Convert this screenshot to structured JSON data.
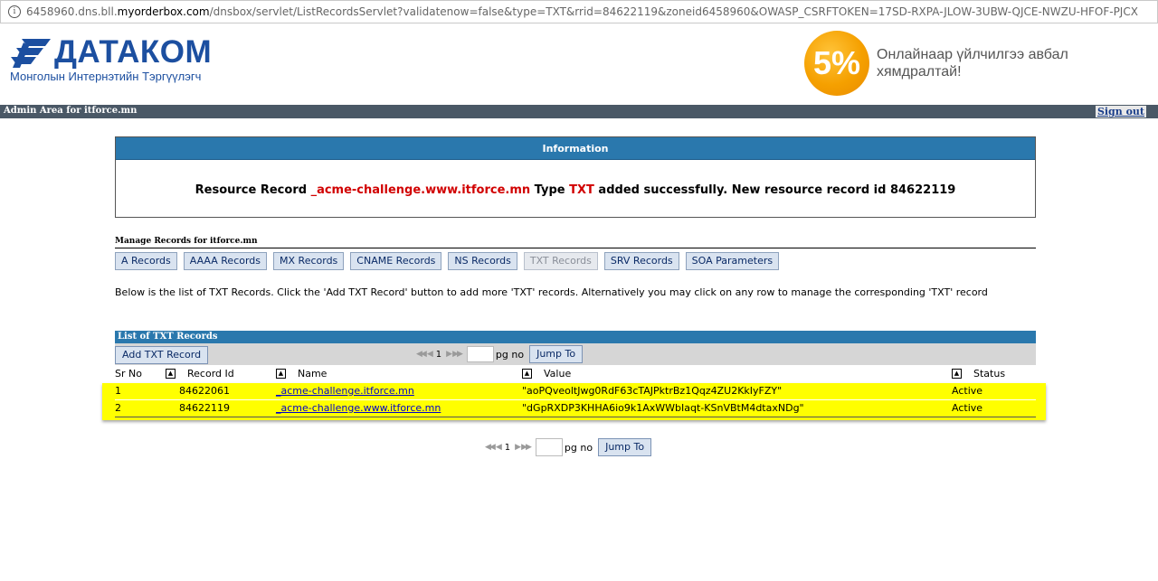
{
  "browser": {
    "url_host_prefix": "6458960.dns.bll.",
    "url_host_domain": "myorderbox.com",
    "url_rest": "/dnsbox/servlet/ListRecordsServlet?validatenow=false&type=TXT&rrid=84622119&zoneid6458960&OWASP_CSRFTOKEN=17SD-RXPA-JLOW-3UBW-QJCE-NWZU-HFOF-PJCX"
  },
  "header": {
    "logo_title": "ДАТАКОМ",
    "logo_subtitle": "Монголын Интернэтийн Тэргүүлэгч",
    "promo_badge": "5%",
    "promo_text": "Онлайнаар үйлчилгээ авбал хямдралтай!"
  },
  "adminbar": {
    "title": "Admin Area for itforce.mn",
    "signout": "Sign out"
  },
  "info": {
    "heading": "Information",
    "msg_part1": "Resource Record ",
    "msg_record": "_acme-challenge.www.itforce.mn",
    "msg_part2": " Type ",
    "msg_type": "TXT",
    "msg_part3": " added successfully. New resource record id 84622119"
  },
  "manage": {
    "title": "Manage Records for itforce.mn",
    "tabs": [
      "A Records",
      "AAAA Records",
      "MX Records",
      "CNAME Records",
      "NS Records",
      "TXT Records",
      "SRV Records",
      "SOA Parameters"
    ],
    "description": "Below is the list of TXT Records. Click the 'Add TXT Record' button to add more 'TXT' records. Alternatively you may click on any row to manage the corresponding 'TXT' record"
  },
  "list": {
    "title": "List of TXT Records",
    "add_button": "Add TXT Record",
    "pager": {
      "first": "◀◀",
      "prev": "◀",
      "page": "1",
      "next": "▶",
      "last": "▶▶",
      "pg_no_label": "pg no",
      "jump_label": "Jump To"
    },
    "columns": [
      "Sr No",
      "Record Id",
      "Name",
      "Value",
      "Status"
    ],
    "sort_icon": "▲",
    "rows": [
      {
        "sr": "1",
        "id": "84622061",
        "name": "_acme-challenge.itforce.mn",
        "value": "\"aoPQveoltJwg0RdF63cTAJPktrBz1Qqz4ZU2KkIyFZY\"",
        "status": "Active"
      },
      {
        "sr": "2",
        "id": "84622119",
        "name": "_acme-challenge.www.itforce.mn",
        "value": "\"dGpRXDP3KHHA6io9k1AxWWbIaqt-KSnVBtM4dtaxNDg\"",
        "status": "Active"
      }
    ]
  }
}
